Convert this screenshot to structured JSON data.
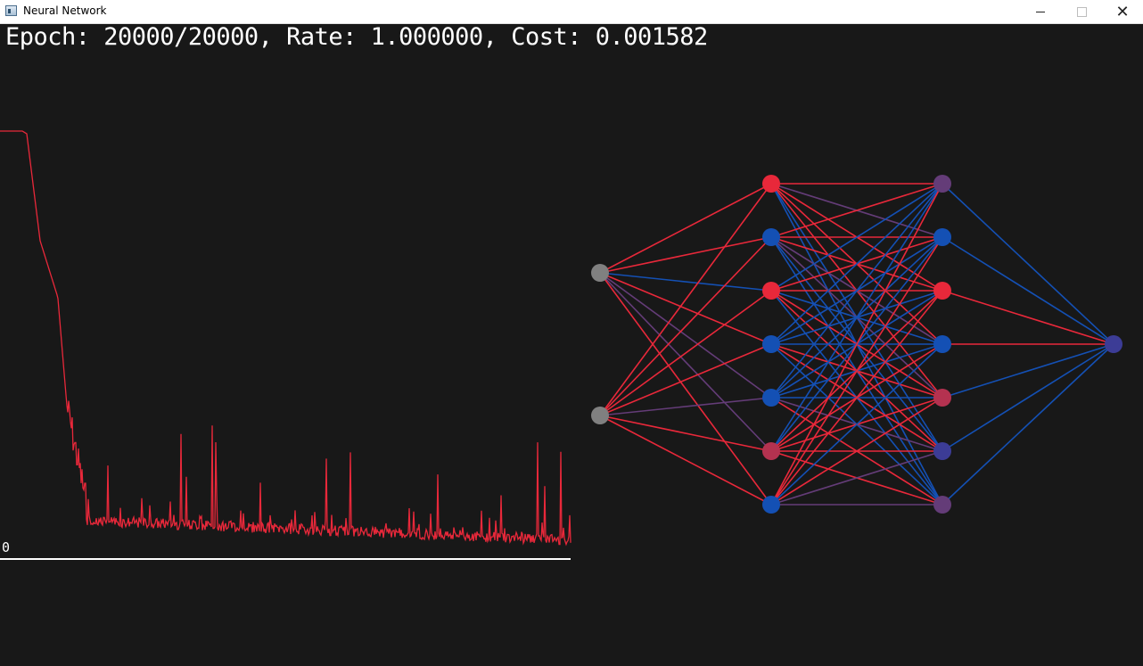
{
  "window": {
    "title": "Neural Network",
    "controls": {
      "minimize": "minimize",
      "maximize": "maximize",
      "close": "✕"
    }
  },
  "status": {
    "text": "Epoch: 20000/20000, Rate: 1.000000, Cost: 0.001582"
  },
  "cost_plot": {
    "zero_label": "0",
    "line_color": "#e8283a",
    "axis_color": "#ffffff"
  },
  "network": {
    "layers": [
      2,
      7,
      7,
      1
    ],
    "neuron_colors": [
      [
        "#808080",
        "#808080"
      ],
      [
        "#e8283a",
        "#1450b4",
        "#e8283a",
        "#1450b4",
        "#1450b4",
        "#b43250",
        "#1450b4"
      ],
      [
        "#643c78",
        "#1450b4",
        "#e8283a",
        "#1450b4",
        "#b43250",
        "#3c3c96",
        "#643c78"
      ],
      [
        "#3c3c96"
      ]
    ],
    "weight_colors": {
      "positive": "#e8283a",
      "negative": "#1450b4",
      "neutral": "#643c78"
    }
  }
}
